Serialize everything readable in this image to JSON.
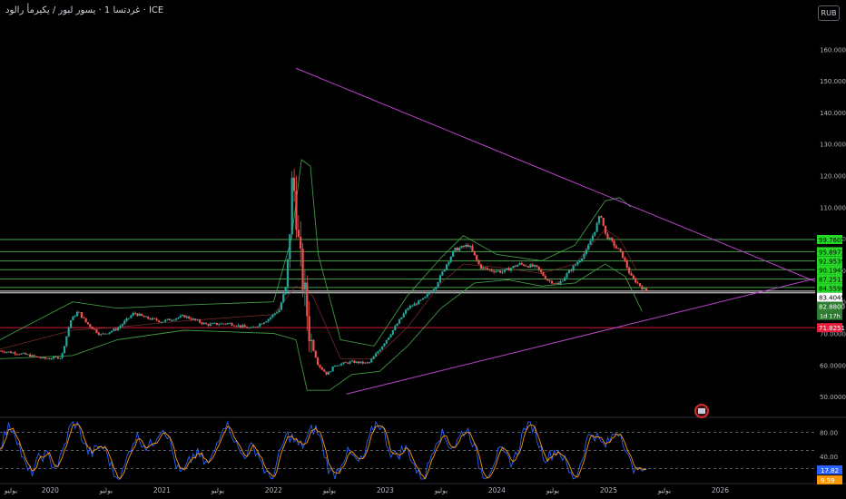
{
  "header": {
    "title": "غردتسا 1 · يسور لبور / يكيرمأ رالود · ICE",
    "currency_button": "RUB"
  },
  "chart_data": {
    "type": "candlestick",
    "instrument": "USD/RUB",
    "timeframe": "1W",
    "price_axis": {
      "ylim": [
        44,
        167
      ],
      "ticks": [
        50,
        60,
        70,
        80,
        90,
        100,
        110,
        120,
        130,
        140,
        150,
        160
      ],
      "tick_labels": [
        "50.0000",
        "60.0000",
        "70.0000",
        "80.0000",
        "90.0000",
        "100.0000",
        "110.0000",
        "120.0000",
        "130.0000",
        "140.0000",
        "150.0000",
        "160.0000"
      ]
    },
    "time_axis": {
      "xlim": [
        2019.55,
        2026.85
      ],
      "labels": [
        {
          "x": 2019.5,
          "text": "يوليو"
        },
        {
          "x": 2020.0,
          "text": "2020"
        },
        {
          "x": 2020.5,
          "text": "يوليو"
        },
        {
          "x": 2021.0,
          "text": "2021"
        },
        {
          "x": 2021.5,
          "text": "يوليو"
        },
        {
          "x": 2022.0,
          "text": "2022"
        },
        {
          "x": 2022.5,
          "text": "يوليو"
        },
        {
          "x": 2023.0,
          "text": "2023"
        },
        {
          "x": 2023.5,
          "text": "يوليو"
        },
        {
          "x": 2024.0,
          "text": "2024"
        },
        {
          "x": 2024.5,
          "text": "يوليو"
        },
        {
          "x": 2025.0,
          "text": "2025"
        },
        {
          "x": 2025.5,
          "text": "يوليو"
        },
        {
          "x": 2026.0,
          "text": "2026"
        }
      ]
    },
    "price_path": [
      [
        2019.55,
        64.5
      ],
      [
        2019.75,
        63.5
      ],
      [
        2019.95,
        62.0
      ],
      [
        2020.1,
        62.5
      ],
      [
        2020.18,
        74.0
      ],
      [
        2020.25,
        77.0
      ],
      [
        2020.32,
        73.5
      ],
      [
        2020.45,
        69.5
      ],
      [
        2020.6,
        71.5
      ],
      [
        2020.75,
        76.5
      ],
      [
        2020.85,
        75.0
      ],
      [
        2021.0,
        73.8
      ],
      [
        2021.2,
        75.5
      ],
      [
        2021.4,
        72.8
      ],
      [
        2021.6,
        73.2
      ],
      [
        2021.8,
        71.5
      ],
      [
        2021.95,
        74.5
      ],
      [
        2022.05,
        77.5
      ],
      [
        2022.12,
        86.0
      ],
      [
        2022.17,
        120.0
      ],
      [
        2022.2,
        110.0
      ],
      [
        2022.23,
        95.0
      ],
      [
        2022.28,
        82.0
      ],
      [
        2022.33,
        68.0
      ],
      [
        2022.4,
        60.0
      ],
      [
        2022.48,
        57.0
      ],
      [
        2022.55,
        60.0
      ],
      [
        2022.7,
        61.0
      ],
      [
        2022.85,
        60.5
      ],
      [
        2022.95,
        65.0
      ],
      [
        2023.05,
        70.0
      ],
      [
        2023.2,
        78.0
      ],
      [
        2023.35,
        81.0
      ],
      [
        2023.45,
        85.0
      ],
      [
        2023.55,
        92.0
      ],
      [
        2023.62,
        96.5
      ],
      [
        2023.75,
        98.0
      ],
      [
        2023.85,
        91.0
      ],
      [
        2023.95,
        90.0
      ],
      [
        2024.05,
        89.5
      ],
      [
        2024.2,
        92.0
      ],
      [
        2024.35,
        91.0
      ],
      [
        2024.45,
        87.0
      ],
      [
        2024.55,
        85.5
      ],
      [
        2024.62,
        88.5
      ],
      [
        2024.72,
        92.5
      ],
      [
        2024.8,
        96.0
      ],
      [
        2024.88,
        103.0
      ],
      [
        2024.93,
        108.0
      ],
      [
        2024.97,
        101.5
      ],
      [
        2025.05,
        98.0
      ],
      [
        2025.12,
        95.0
      ],
      [
        2025.2,
        88.0
      ],
      [
        2025.3,
        84.5
      ],
      [
        2025.35,
        82.9
      ]
    ],
    "bollinger": {
      "upper": [
        [
          2019.55,
          68
        ],
        [
          2020.2,
          80
        ],
        [
          2020.6,
          78
        ],
        [
          2021.2,
          79
        ],
        [
          2022.0,
          80
        ],
        [
          2022.16,
          100
        ],
        [
          2022.25,
          125
        ],
        [
          2022.33,
          123
        ],
        [
          2022.4,
          95
        ],
        [
          2022.6,
          68
        ],
        [
          2022.9,
          66
        ],
        [
          2023.2,
          82
        ],
        [
          2023.5,
          94
        ],
        [
          2023.7,
          101
        ],
        [
          2024.0,
          95
        ],
        [
          2024.4,
          93
        ],
        [
          2024.7,
          98
        ],
        [
          2024.97,
          112
        ],
        [
          2025.1,
          113
        ],
        [
          2025.2,
          110
        ]
      ],
      "middle": [
        [
          2019.55,
          65
        ],
        [
          2020.2,
          71
        ],
        [
          2020.6,
          72
        ],
        [
          2021.2,
          74
        ],
        [
          2022.0,
          76
        ],
        [
          2022.2,
          85
        ],
        [
          2022.35,
          82
        ],
        [
          2022.6,
          62
        ],
        [
          2022.9,
          62
        ],
        [
          2023.2,
          72
        ],
        [
          2023.5,
          86
        ],
        [
          2023.7,
          92
        ],
        [
          2024.0,
          91
        ],
        [
          2024.4,
          89
        ],
        [
          2024.7,
          92
        ],
        [
          2024.97,
          103
        ],
        [
          2025.1,
          100
        ],
        [
          2025.25,
          90
        ]
      ],
      "lower": [
        [
          2019.55,
          62
        ],
        [
          2020.2,
          63
        ],
        [
          2020.6,
          68
        ],
        [
          2021.2,
          71
        ],
        [
          2022.0,
          70
        ],
        [
          2022.2,
          68
        ],
        [
          2022.3,
          52
        ],
        [
          2022.5,
          52
        ],
        [
          2022.7,
          57
        ],
        [
          2022.95,
          58
        ],
        [
          2023.2,
          66
        ],
        [
          2023.5,
          78
        ],
        [
          2023.8,
          86
        ],
        [
          2024.1,
          87
        ],
        [
          2024.4,
          85
        ],
        [
          2024.7,
          86
        ],
        [
          2024.97,
          92
        ],
        [
          2025.15,
          88
        ],
        [
          2025.3,
          77
        ]
      ]
    },
    "trend_lines": [
      {
        "name": "",
        "color": "#b943c9",
        "from": [
          2022.2,
          154
        ],
        "to": [
          2026.85,
          86.5
        ]
      },
      {
        "name": "",
        "color": "#b943c9",
        "from": [
          2022.65,
          50.8
        ],
        "to": [
          2026.85,
          87.4
        ]
      }
    ],
    "levels": [
      {
        "value": 99.7605,
        "label": "99.7605",
        "color": "#4caf50"
      },
      {
        "value": 95.8973,
        "label": "95.8973",
        "color": "#4caf50"
      },
      {
        "value": 92.9539,
        "label": "92.9539",
        "color": "#4caf50"
      },
      {
        "value": 90.1945,
        "label": "90.1945",
        "color": "#4caf50"
      },
      {
        "value": 87.2511,
        "label": "87.2511",
        "color": "#4caf50"
      },
      {
        "value": 84.5596,
        "label": "84.5596",
        "color": "#4caf50"
      },
      {
        "value": 83.4045,
        "label": "83.4045",
        "color": "#ffffff"
      },
      {
        "value": 82.88,
        "label": "82.8800",
        "color": "#ffffff"
      },
      {
        "value": 71.8251,
        "label": "71.8251",
        "color": "#e91e3f"
      }
    ],
    "current_price": {
      "value": "82.8800",
      "countdown": "1d 17h",
      "color": "#2e7d32"
    },
    "oscillator": {
      "type": "stochastic",
      "ylim": [
        0,
        100
      ],
      "ticks": [
        40,
        80
      ],
      "tick_labels": [
        "40.00",
        "80.00"
      ],
      "bands": [
        20,
        50,
        80
      ],
      "values": [
        "17.82",
        "9.59"
      ],
      "colors": [
        "#2962ff",
        "#ff9800"
      ]
    }
  }
}
